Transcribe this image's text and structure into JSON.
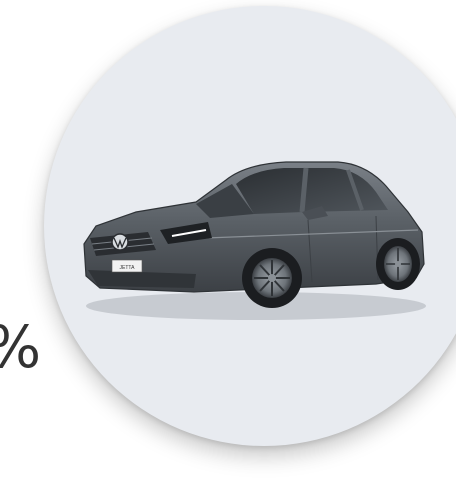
{
  "promo": {
    "percent_fragment": "%",
    "image": {
      "icon": "sedan-car-image",
      "plate_text": "JETTA"
    }
  },
  "colors": {
    "circle_bg": "#e8ebf0",
    "car_body": "#5b6167",
    "text": "#333333"
  }
}
